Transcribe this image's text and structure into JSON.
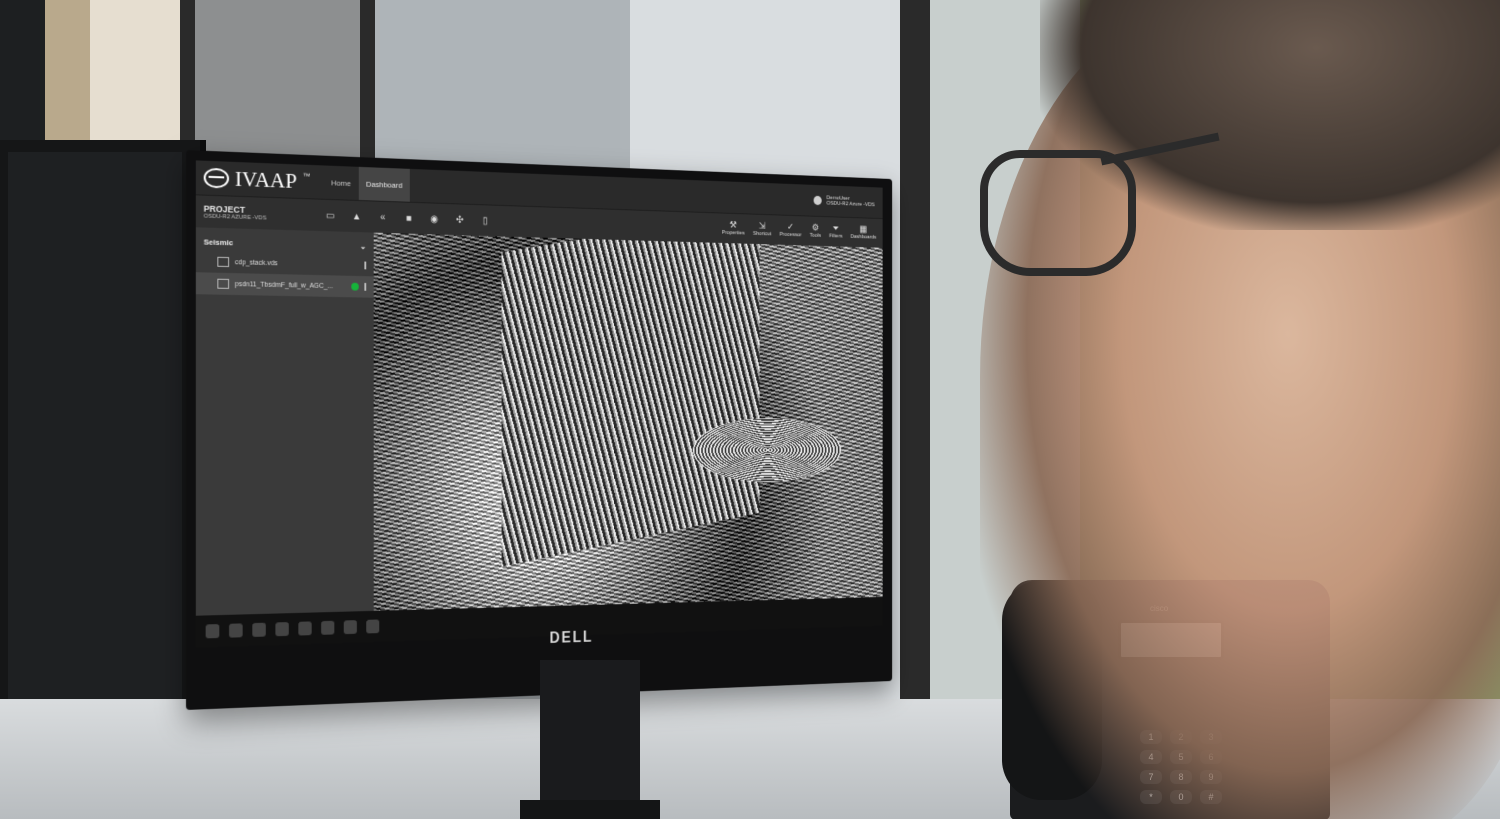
{
  "app": {
    "brand": "IVAAP",
    "brand_tm": "™",
    "tabs": [
      {
        "label": "Home"
      },
      {
        "label": "Dashboard"
      }
    ],
    "user": {
      "name": "DemoUser",
      "context": "OSDU-R2 Azure -VDS"
    }
  },
  "toolbar": {
    "project_label": "PROJECT",
    "project_value": "OSDU-R2 AZURE -VDS",
    "right_tools": [
      {
        "label": "Properties",
        "icon": "wrench-icon"
      },
      {
        "label": "Shortcut",
        "icon": "cursor-icon"
      },
      {
        "label": "Processor",
        "icon": "check-icon"
      },
      {
        "label": "Tools",
        "icon": "tools-icon"
      },
      {
        "label": "Filters",
        "icon": "filter-icon"
      },
      {
        "label": "Dashboards",
        "icon": "grid-icon"
      }
    ]
  },
  "sidebar": {
    "section": "Seismic",
    "items": [
      {
        "label": "cdp_stack.vds"
      },
      {
        "label": "psdn11_TbsdmF_full_w_AGC_..."
      }
    ]
  },
  "phone": {
    "brand": "cisco",
    "keys": [
      "1",
      "2",
      "3",
      "4",
      "5",
      "6",
      "7",
      "8",
      "9",
      "*",
      "0",
      "#"
    ]
  },
  "monitor": {
    "logo": "DELL"
  },
  "colors": {
    "status_dot": "#16b33a",
    "toolbar_bg": "#2f2f2f",
    "sidebar_bg": "#3a3a3a"
  }
}
